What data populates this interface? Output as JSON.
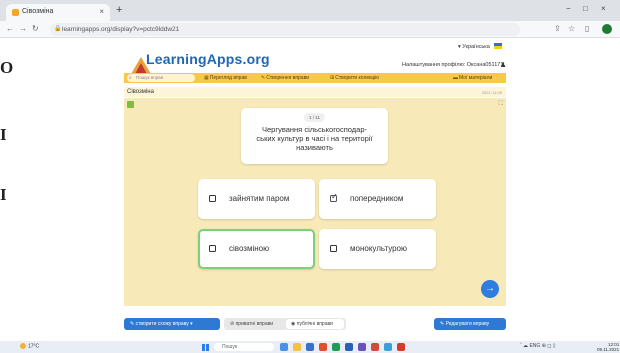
{
  "side_letters": [
    "O",
    "I",
    "I"
  ],
  "browser": {
    "tab_title": "Сівозміна",
    "url": "learningapps.org/display?v=pctc9lddw21",
    "new_tab": "+",
    "window_controls": [
      "−",
      "□",
      "×"
    ]
  },
  "header": {
    "language": "▾ Українська",
    "logo": "LearningApps.org",
    "profile_settings": "Налаштування профілю: Оксана051171"
  },
  "nav": {
    "search_placeholder": "Пошук вправ",
    "items": [
      {
        "label": "Перегляд вправ",
        "icon": "grid-icon"
      },
      {
        "label": "Створення вправи",
        "icon": "pencil-icon"
      },
      {
        "label": "Створити колекцію",
        "icon": "collection-icon"
      },
      {
        "label": "Мої матеріали",
        "icon": "folder-icon"
      }
    ]
  },
  "app": {
    "title": "Сівозміна",
    "date": "2021-11-09",
    "counter": "1 / 11",
    "question": "Чергування сільськогосподар-\nських культур в часі і на території\nназивають",
    "options": [
      {
        "label": "зайнятим паром",
        "checked": false,
        "selected": false
      },
      {
        "label": "попередником",
        "checked": true,
        "selected": false
      },
      {
        "label": "сівозміною",
        "checked": false,
        "selected": true
      },
      {
        "label": "монокультурою",
        "checked": false,
        "selected": false
      }
    ],
    "next_icon": "→"
  },
  "bottom": {
    "create": "створити схожу вправу ▾",
    "private": "приватні вправи",
    "public": "публічні вправи",
    "edit": "Редагувати вправу"
  },
  "taskbar": {
    "weather": "17°C",
    "search": "Пошук",
    "tray": "ˆ ☁ ENG  ⊕ ◻ ▯",
    "time": "12:01",
    "date": "09.11.2021"
  },
  "colors": {
    "brand": "#1f66b3",
    "nav_yellow": "#f8c84a",
    "app_bg": "#f8e9b8",
    "selected_border": "#7cd07a",
    "button_blue": "#2e79d4"
  }
}
